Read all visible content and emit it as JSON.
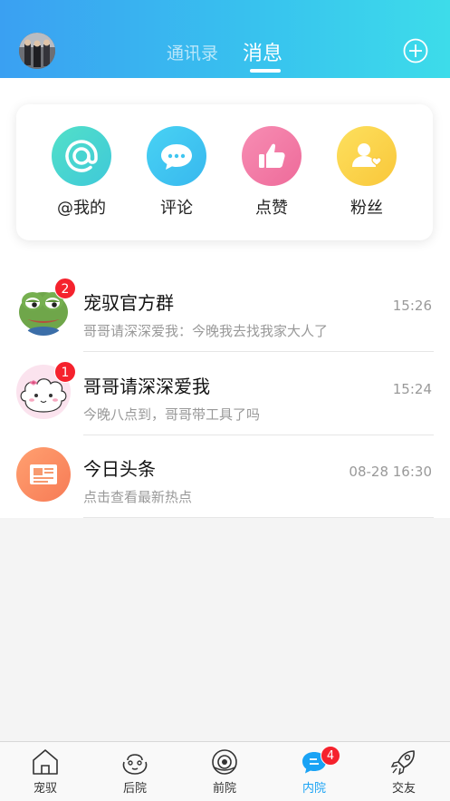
{
  "header": {
    "tabs": [
      {
        "label": "通讯录",
        "active": false
      },
      {
        "label": "消息",
        "active": true
      }
    ],
    "accent": "#3aa0f2"
  },
  "quick_actions": [
    {
      "label": "@我的",
      "icon": "at-icon",
      "color": "#4dd6c8"
    },
    {
      "label": "评论",
      "icon": "comment-bubble-icon",
      "color": "#3fc6f0"
    },
    {
      "label": "点赞",
      "icon": "thumbs-up-icon",
      "color": "#f27aa6"
    },
    {
      "label": "粉丝",
      "icon": "fans-heart-icon",
      "color": "#fbd34a"
    }
  ],
  "messages": [
    {
      "title": "宠驭官方群",
      "preview": "哥哥请深深爱我：今晚我去找我家大人了",
      "time": "15:26",
      "badge": "2",
      "avatar": "frog-avatar-icon"
    },
    {
      "title": "哥哥请深深爱我",
      "preview": "今晚八点到，哥哥带工具了吗",
      "time": "15:24",
      "badge": "1",
      "avatar": "cloud-girl-avatar-icon"
    },
    {
      "title": "今日头条",
      "preview": "点击查看最新热点",
      "time": "08-28 16:30",
      "badge": "",
      "avatar": "newspaper-icon"
    }
  ],
  "tabbar": {
    "items": [
      {
        "label": "宠驭",
        "icon": "home-icon",
        "active": false
      },
      {
        "label": "后院",
        "icon": "backyard-icon",
        "active": false
      },
      {
        "label": "前院",
        "icon": "eye-planet-icon",
        "active": false
      },
      {
        "label": "内院",
        "icon": "chat-icon",
        "active": true,
        "badge": "4"
      },
      {
        "label": "交友",
        "icon": "rocket-icon",
        "active": false
      }
    ],
    "active_color": "#1aa3f5",
    "badge_color": "#f5222d"
  }
}
